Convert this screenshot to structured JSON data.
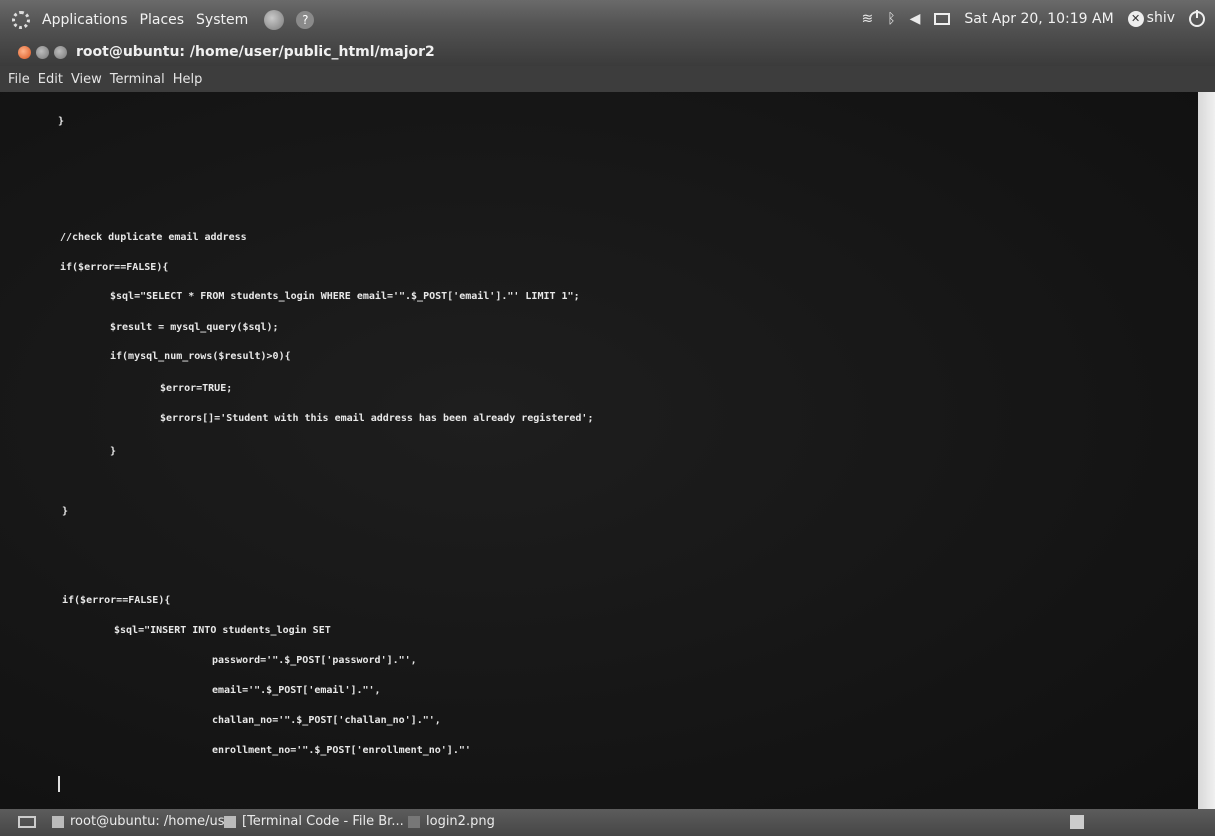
{
  "top_panel": {
    "menus": [
      "Applications",
      "Places",
      "System"
    ],
    "datetime": "Sat Apr 20, 10:19 AM",
    "user": "shiv"
  },
  "window": {
    "title": "root@ubuntu: /home/user/public_html/major2"
  },
  "menubar": [
    "File",
    "Edit",
    "View",
    "Terminal",
    "Help"
  ],
  "code_lines": [
    "}",
    "//check duplicate email address",
    "if($error==FALSE){",
    "$sql=\"SELECT * FROM students_login WHERE email='\".$_POST['email'].\"' LIMIT 1\";",
    "$result = mysql_query($sql);",
    "if(mysql_num_rows($result)>0){",
    "$error=TRUE;",
    "$errors[]='Student with this email address has been already registered';",
    "}",
    "}",
    "if($error==FALSE){",
    "$sql=\"INSERT INTO students_login SET",
    "password='\".$_POST['password'].\"',",
    "email='\".$_POST['email'].\"',",
    "challan_no='\".$_POST['challan_no'].\"',",
    "enrollment_no='\".$_POST['enrollment_no'].\"'"
  ],
  "taskbar": {
    "tasks": [
      "root@ubuntu: /home/us...",
      "[Terminal Code - File Br...",
      "login2.png"
    ]
  }
}
